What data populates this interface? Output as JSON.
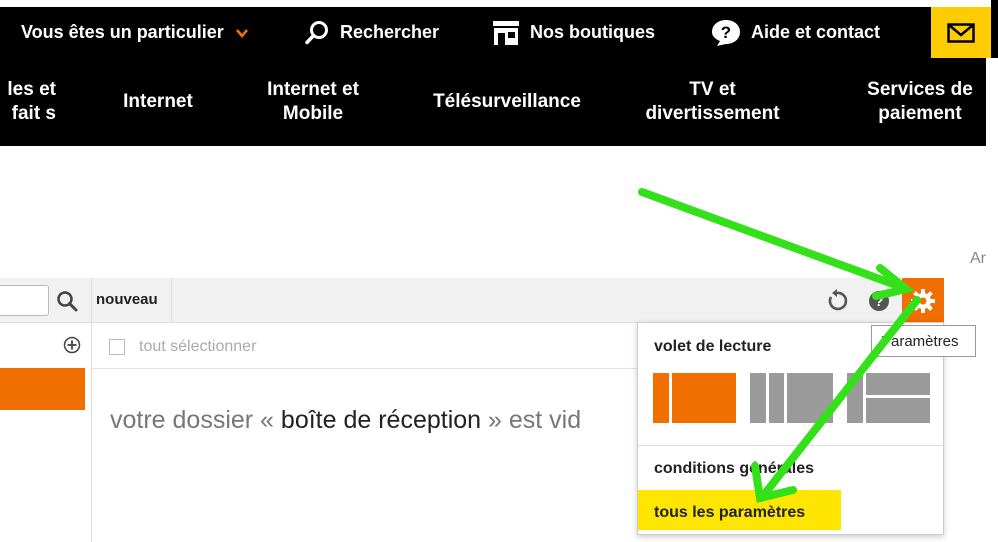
{
  "topbar": {
    "particulier_label": "Vous êtes un particulier",
    "search_label": "Rechercher",
    "shops_label": "Nos boutiques",
    "help_label": "Aide et contact",
    "mail_icon": "mail-icon",
    "accent": "#ffcc00"
  },
  "nav": {
    "items": [
      {
        "line1": "les et",
        "line2": "fait s"
      },
      {
        "line1": "Internet",
        "line2": ""
      },
      {
        "line1": "Internet et",
        "line2": "Mobile"
      },
      {
        "line1": "Télésurveillance",
        "line2": ""
      },
      {
        "line1": "TV et",
        "line2": "divertissement"
      },
      {
        "line1": "Services de",
        "line2": "paiement"
      }
    ]
  },
  "corner_text": "Ar",
  "toolbar": {
    "new_label": "nouveau",
    "refresh_icon": "refresh-icon",
    "help_icon": "help-icon",
    "settings_icon": "gear-icon",
    "settings_color": "#f16e00"
  },
  "mailbox": {
    "select_all_label": "tout sélectionner",
    "empty_prefix": "votre dossier « ",
    "folder_name": "boîte de réception",
    "empty_suffix": " » est vid"
  },
  "settings_menu": {
    "reading_pane_title": "volet de lecture",
    "layouts": [
      "layout-left",
      "layout-columns",
      "layout-rows"
    ],
    "terms_label": "conditions générales",
    "all_settings_label": "tous les paramètres",
    "highlight_color": "#ffe600"
  },
  "tooltip": "Paramètres"
}
